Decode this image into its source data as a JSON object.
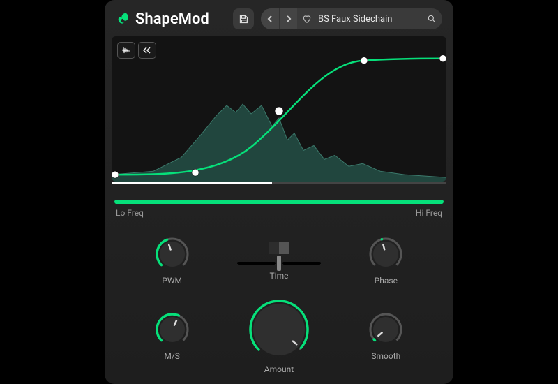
{
  "brand": {
    "name": "ShapeMod"
  },
  "header": {
    "preset_name": "BS Faux Sidechain"
  },
  "freq": {
    "lo_label": "Lo Freq",
    "hi_label": "Hi Freq"
  },
  "controls": {
    "pwm": {
      "label": "PWM",
      "angle_deg": -20,
      "arc_start": -135,
      "arc_end": -20
    },
    "time": {
      "label": "Time"
    },
    "phase": {
      "label": "Phase",
      "angle_deg": -15,
      "arc_start": -15,
      "arc_end": -15
    },
    "ms": {
      "label": "M/S",
      "angle_deg": 25,
      "arc_start": -135,
      "arc_end": 25
    },
    "amount": {
      "label": "Amount",
      "angle_deg": 130,
      "arc_start": -135,
      "arc_end": 130
    },
    "smooth": {
      "label": "Smooth",
      "angle_deg": -130,
      "arc_start": -135,
      "arc_end": -130
    }
  },
  "colors": {
    "accent": "#06e07a"
  }
}
